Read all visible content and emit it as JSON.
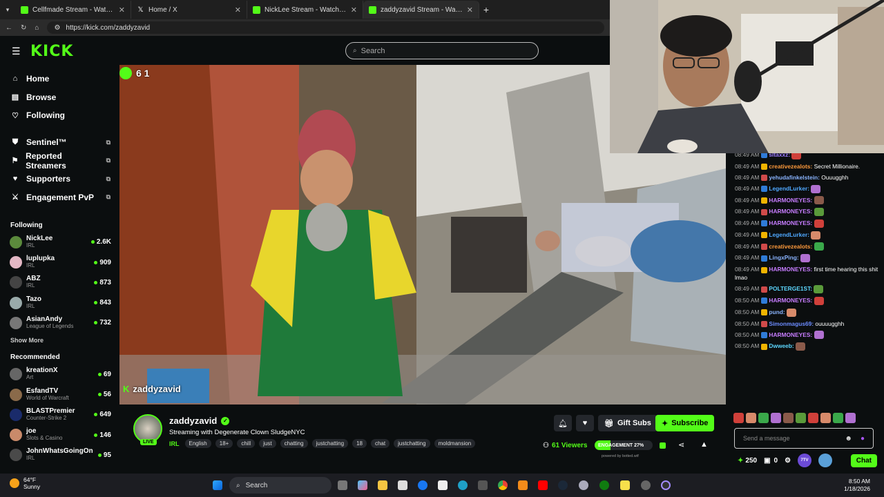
{
  "browser": {
    "tabs": [
      {
        "title": "Cellfmade Stream - Watch Li",
        "favicon": "kick-favicon"
      },
      {
        "title": "Home / X",
        "favicon": "x-favicon"
      },
      {
        "title": "NickLee Stream - Watch Live",
        "favicon": "kick-favicon"
      },
      {
        "title": "zaddyzavid Stream - Watch Li",
        "favicon": "kick-favicon"
      }
    ],
    "url": "https://kick.com/zaddyzavid"
  },
  "header": {
    "logo": "KICK",
    "search_placeholder": "Search"
  },
  "sidebar": {
    "nav": [
      {
        "label": "Home",
        "icon": "home-icon"
      },
      {
        "label": "Browse",
        "icon": "browse-icon"
      },
      {
        "label": "Following",
        "icon": "heart-icon"
      }
    ],
    "tools": [
      {
        "label": "Sentinel™",
        "icon": "shield-icon"
      },
      {
        "label": "Reported Streamers",
        "icon": "flag-icon"
      },
      {
        "label": "Supporters",
        "icon": "heart-icon"
      },
      {
        "label": "Engagement PvP",
        "icon": "swords-icon"
      }
    ],
    "following_title": "Following",
    "following": [
      {
        "name": "NickLee",
        "category": "IRL",
        "viewers": "2.6K"
      },
      {
        "name": "luplupka",
        "category": "IRL",
        "viewers": "909"
      },
      {
        "name": "ABZ",
        "category": "IRL",
        "viewers": "873"
      },
      {
        "name": "Tazo",
        "category": "IRL",
        "viewers": "843"
      },
      {
        "name": "AsianAndy",
        "category": "League of Legends",
        "viewers": "732"
      }
    ],
    "show_more": "Show More",
    "recommended_title": "Recommended",
    "recommended": [
      {
        "name": "kreationX",
        "category": "Art",
        "viewers": "69"
      },
      {
        "name": "EsfandTV",
        "category": "World of Warcraft",
        "viewers": "56"
      },
      {
        "name": "BLASTPremier",
        "category": "Counter-Strike 2",
        "viewers": "649"
      },
      {
        "name": "joe",
        "category": "Slots & Casino",
        "viewers": "146"
      },
      {
        "name": "JohnWhatsGoingOn",
        "category": "IRL",
        "viewers": "95"
      }
    ]
  },
  "video": {
    "overlay_count": "6 1",
    "watermark": "zaddyzavid"
  },
  "stream": {
    "name": "zaddyzavid",
    "live_label": "LIVE",
    "title": "Streaming with Degenerate Clown SludgeNYC",
    "category": "IRL",
    "tags": [
      "English",
      "18+",
      "chill",
      "just",
      "chatting",
      "justchatting",
      "18",
      "chat",
      "justchatting",
      "moldmansion"
    ],
    "gift_label": "Gift Subs",
    "subscribe_label": "Subscribe",
    "viewers": "61 Viewers",
    "engagement_label": "ENGAGEMENT 27%",
    "engagement_value": 0.27,
    "powered": "powered by botted.wtf"
  },
  "chat": {
    "messages": [
      {
        "time": "08:49 AM",
        "user": "sltaxxz:",
        "color": "#9d7bff",
        "text": ""
      },
      {
        "time": "08:49 AM",
        "user": "creativezealots:",
        "color": "#ff9a3c",
        "text": "Secret Millionaire."
      },
      {
        "time": "08:49 AM",
        "user": "yehudafinkelstein:",
        "color": "#8ab4ff",
        "text": "Ouuugghh"
      },
      {
        "time": "08:49 AM",
        "user": "LegendLurker:",
        "color": "#4fa8ff",
        "text": ""
      },
      {
        "time": "08:49 AM",
        "user": "HARMONEYES:",
        "color": "#c77dff",
        "text": ""
      },
      {
        "time": "08:49 AM",
        "user": "HARMONEYES:",
        "color": "#c77dff",
        "text": ""
      },
      {
        "time": "08:49 AM",
        "user": "HARMONEYES:",
        "color": "#c77dff",
        "text": ""
      },
      {
        "time": "08:49 AM",
        "user": "LegendLurker:",
        "color": "#4fa8ff",
        "text": ""
      },
      {
        "time": "08:49 AM",
        "user": "creativezealots:",
        "color": "#ff9a3c",
        "text": ""
      },
      {
        "time": "08:49 AM",
        "user": "LingxPing:",
        "color": "#8ab4ff",
        "text": ""
      },
      {
        "time": "08:49 AM",
        "user": "HARMONEYES:",
        "color": "#c77dff",
        "text": "first time hearing this shit lmao"
      },
      {
        "time": "08:49 AM",
        "user": "POLTERGE1ST:",
        "color": "#5cd6ff",
        "text": ""
      },
      {
        "time": "08:50 AM",
        "user": "HARMONEYES:",
        "color": "#c77dff",
        "text": ""
      },
      {
        "time": "08:50 AM",
        "user": "pund:",
        "color": "#8ab4ff",
        "text": ""
      },
      {
        "time": "08:50 AM",
        "user": "Simonmagus69:",
        "color": "#6c8cff",
        "text": "ouuuugghh"
      },
      {
        "time": "08:50 AM",
        "user": "HARMONEYES:",
        "color": "#c77dff",
        "text": ""
      },
      {
        "time": "08:50 AM",
        "user": "Dwweeb:",
        "color": "#5cd6ff",
        "text": ""
      }
    ],
    "input_placeholder": "Send a message",
    "points": "250",
    "gifts": "0",
    "send_label": "Chat"
  },
  "taskbar": {
    "temp": "64°F",
    "condition": "Sunny",
    "search_label": "Search",
    "time": "8:50 AM",
    "date": "1/18/2026"
  }
}
